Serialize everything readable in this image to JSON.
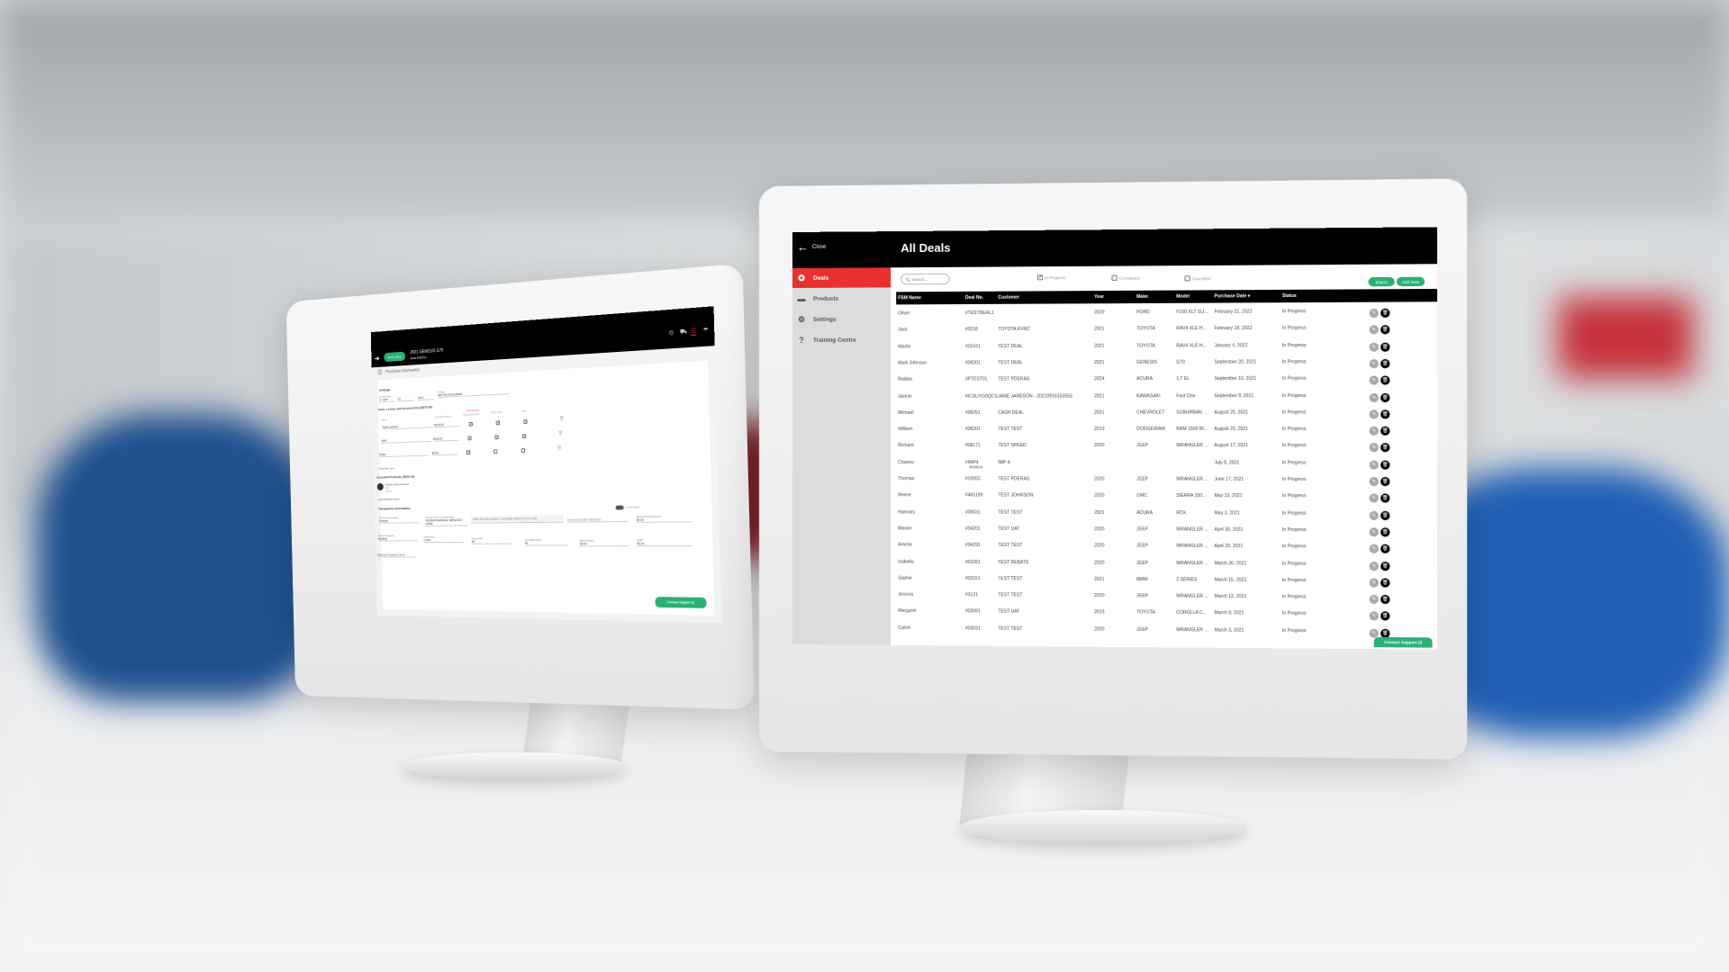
{
  "right_screen": {
    "close_label": "Close",
    "title": "All Deals",
    "sidebar": [
      {
        "label": "Deals",
        "icon": "award-icon",
        "active": true
      },
      {
        "label": "Products",
        "icon": "products-icon"
      },
      {
        "label": "Settings",
        "icon": "gear-icon"
      },
      {
        "label": "Training Centre",
        "icon": "question-icon"
      }
    ],
    "search_placeholder": "Search...",
    "filters": [
      {
        "label": "In Progress",
        "checked": true
      },
      {
        "label": "Completed",
        "checked": false
      },
      {
        "label": "Cancelled",
        "checked": false
      }
    ],
    "import_label": "Import",
    "add_new_label": "Add New",
    "columns": [
      "FSM Name",
      "Deal No.",
      "Customer",
      "Year",
      "Make",
      "Model",
      "Purchase Date ▾",
      "Status"
    ],
    "rows": [
      [
        "Oliver",
        "#TESTDEAL1",
        "",
        "2019",
        "FORD",
        "F150 XLT SU...",
        "February 21, 2022",
        "In Progress"
      ],
      [
        "Jack",
        "#0218",
        "TOYOTA EVRC",
        "2021",
        "TOYOTA",
        "RAV4 XLE H...",
        "February 18, 2022",
        "In Progress"
      ],
      [
        "Martin",
        "#01041",
        "TEST DEAL",
        "2021",
        "TOYOTA",
        "RAV4 XLE H...",
        "January 4, 2022",
        "In Progress"
      ],
      [
        "Mark Johnson",
        "#09201",
        "TEST DEAL",
        "2021",
        "GENESIS",
        "G70",
        "September 20, 2021",
        "In Progress"
      ],
      [
        "Robbin",
        "#PTEST01",
        "TEST PDERAS",
        "2024",
        "ACURA",
        "1.7 EL",
        "September 10, 2021",
        "In Progress"
      ],
      [
        "Jacklin",
        "#ICSUYG0QCS",
        "JANE JANESON - 20210916153553",
        "2021",
        "KAWASAKI",
        "Fast One",
        "September 8, 2021",
        "In Progress"
      ],
      [
        "Michael",
        "#08251",
        "CASH DEAL",
        "2021",
        "CHEVROLET",
        "SUBURBAN ...",
        "August 25, 2021",
        "In Progress"
      ],
      [
        "William",
        "#08201",
        "TEST TEST",
        "2019",
        "DODGE/RAM",
        "RAM 1500 BI...",
        "August 20, 2021",
        "In Progress"
      ],
      [
        "Richard",
        "#08171",
        "TEST SPEED",
        "2020",
        "JEEP",
        "WRANGLER ...",
        "August 17, 2021",
        "In Progress"
      ],
      [
        "Charles",
        "#IMP4",
        "IMP 4",
        "",
        "",
        "",
        "July 9, 2021",
        "In Progress"
      ],
      [
        "Thomas",
        "#1005C",
        "TEST PDERAS",
        "2020",
        "JEEP",
        "WRANGLER ...",
        "June 17, 2021",
        "In Progress"
      ],
      [
        "Reece",
        "#465189",
        "TEST JOHNSON",
        "2020",
        "GMC",
        "SIERRA 150...",
        "May 13, 2021",
        "In Progress"
      ],
      [
        "Hannary",
        "#05031",
        "TEST TEST",
        "2021",
        "ACURA",
        "RDX",
        "May 3, 2021",
        "In Progress"
      ],
      [
        "Mason",
        "#04201",
        "TEST UAT",
        "2020",
        "JEEP",
        "WRANGLER ...",
        "April 30, 2021",
        "In Progress"
      ],
      [
        "Amelia",
        "#04291",
        "TEST TEST",
        "2020",
        "JEEP",
        "WRANGLER ...",
        "April 29, 2021",
        "In Progress"
      ],
      [
        "Isabella",
        "#03261",
        "TEST REBATE",
        "2020",
        "JEEP",
        "WRANGLER ...",
        "March 26, 2021",
        "In Progress"
      ],
      [
        "Sophie",
        "#03151",
        "TEST TEST",
        "2021",
        "BMW",
        "2 SERIES",
        "March 15, 2021",
        "In Progress"
      ],
      [
        "Jessica",
        "#3121",
        "TEST TEST",
        "2020",
        "JEEP",
        "WRANGLER ...",
        "March 12, 2021",
        "In Progress"
      ],
      [
        "Margaret",
        "#03091",
        "TEST UAT",
        "2019",
        "TOYOTA",
        "COROLLA C...",
        "March 9, 2021",
        "In Progress"
      ],
      [
        "Calvin",
        "#03031",
        "TEST TEST",
        "2020",
        "JEEP",
        "WRANGLER ...",
        "March 3, 2021",
        "In Progress"
      ]
    ],
    "stray_label": "Jessica",
    "contact_support_label": "Contact Support ☑",
    "colors": {
      "accent": "#e8302f",
      "green": "#2bb074",
      "header": "#000000"
    }
  },
  "left_screen": {
    "deal_listing_label": "Deal Listing",
    "vehicle_title": "2021 GENESIS G70",
    "deal_number": "Deal #09201",
    "header_icons": [
      "steering-wheel-icon",
      "car-icon",
      "document-icon",
      "umbrella-icon"
    ],
    "section_title": "Purchase Information",
    "settings_title": "Settings",
    "purchase_date_label": "Purchase Date",
    "purchase_month": "9 - SEP",
    "purchase_day": "20",
    "purchase_year": "2021",
    "province_label": "Province",
    "province": "BRITISH COLUMBIA",
    "fees_title": "Fees, Levies, and Accessories ($475.00)",
    "fee_columns": {
      "name": "Name",
      "amount": "Pre-Tax Amount",
      "lease_note": "For Lease Only",
      "due": "Due on Delivery",
      "gst": "GST / HST",
      "pst": "PST"
    },
    "fees": [
      {
        "name": "Mark Johnson",
        "amount": "$375.00",
        "due": true,
        "gst": true,
        "pst": true
      },
      {
        "name": "TIRE",
        "amount": "$100.00",
        "due": true,
        "gst": true,
        "pst": true
      },
      {
        "name": "PPSA",
        "amount": "$0.00",
        "due": true,
        "gst": false,
        "pst": false
      }
    ],
    "add_fee_label": "+ Add Fee / Levy",
    "products_title": "Included Products ($550.00)",
    "product": {
      "name": "Scratch & Dent Removal",
      "sub": "Wins",
      "price": "$550.00"
    },
    "add_product_label": "+ Add Included Product",
    "transaction_title": "Transaction Information",
    "luxury_label": "Luxury Taxes",
    "required": "Required",
    "fields": {
      "payment_type": {
        "label": "Payment Type",
        "value": "Finance"
      },
      "lender": {
        "label": "Secured Lender / Lienholder Name",
        "value": "ACURA FINANCIAL SERVICES CANA"
      },
      "other_lender": {
        "placeholder": "Other Secured Lender / Lienholder Name (if not in list)"
      },
      "lender_phone": {
        "placeholder": "Secured Lender Telephone"
      },
      "approved_amount": {
        "label": "Approved Finance Amount",
        "value": "$0.00"
      },
      "frequency": {
        "label": "Payment Frequency",
        "value": "Monthly"
      },
      "interest": {
        "label": "Interest Rate",
        "value": "0.00%"
      },
      "term": {
        "label": "Finance Term",
        "value": "48"
      },
      "amortization": {
        "label": "Amortization Period",
        "value": "48"
      },
      "balloon": {
        "label": "Balloon Amount",
        "value": "$0.00"
      },
      "msrp": {
        "label": "MSRP",
        "value": "$0.00"
      },
      "deferral": {
        "placeholder": "Deferral Payment Term"
      }
    },
    "contact_support_label": "Contact Support ☑"
  }
}
